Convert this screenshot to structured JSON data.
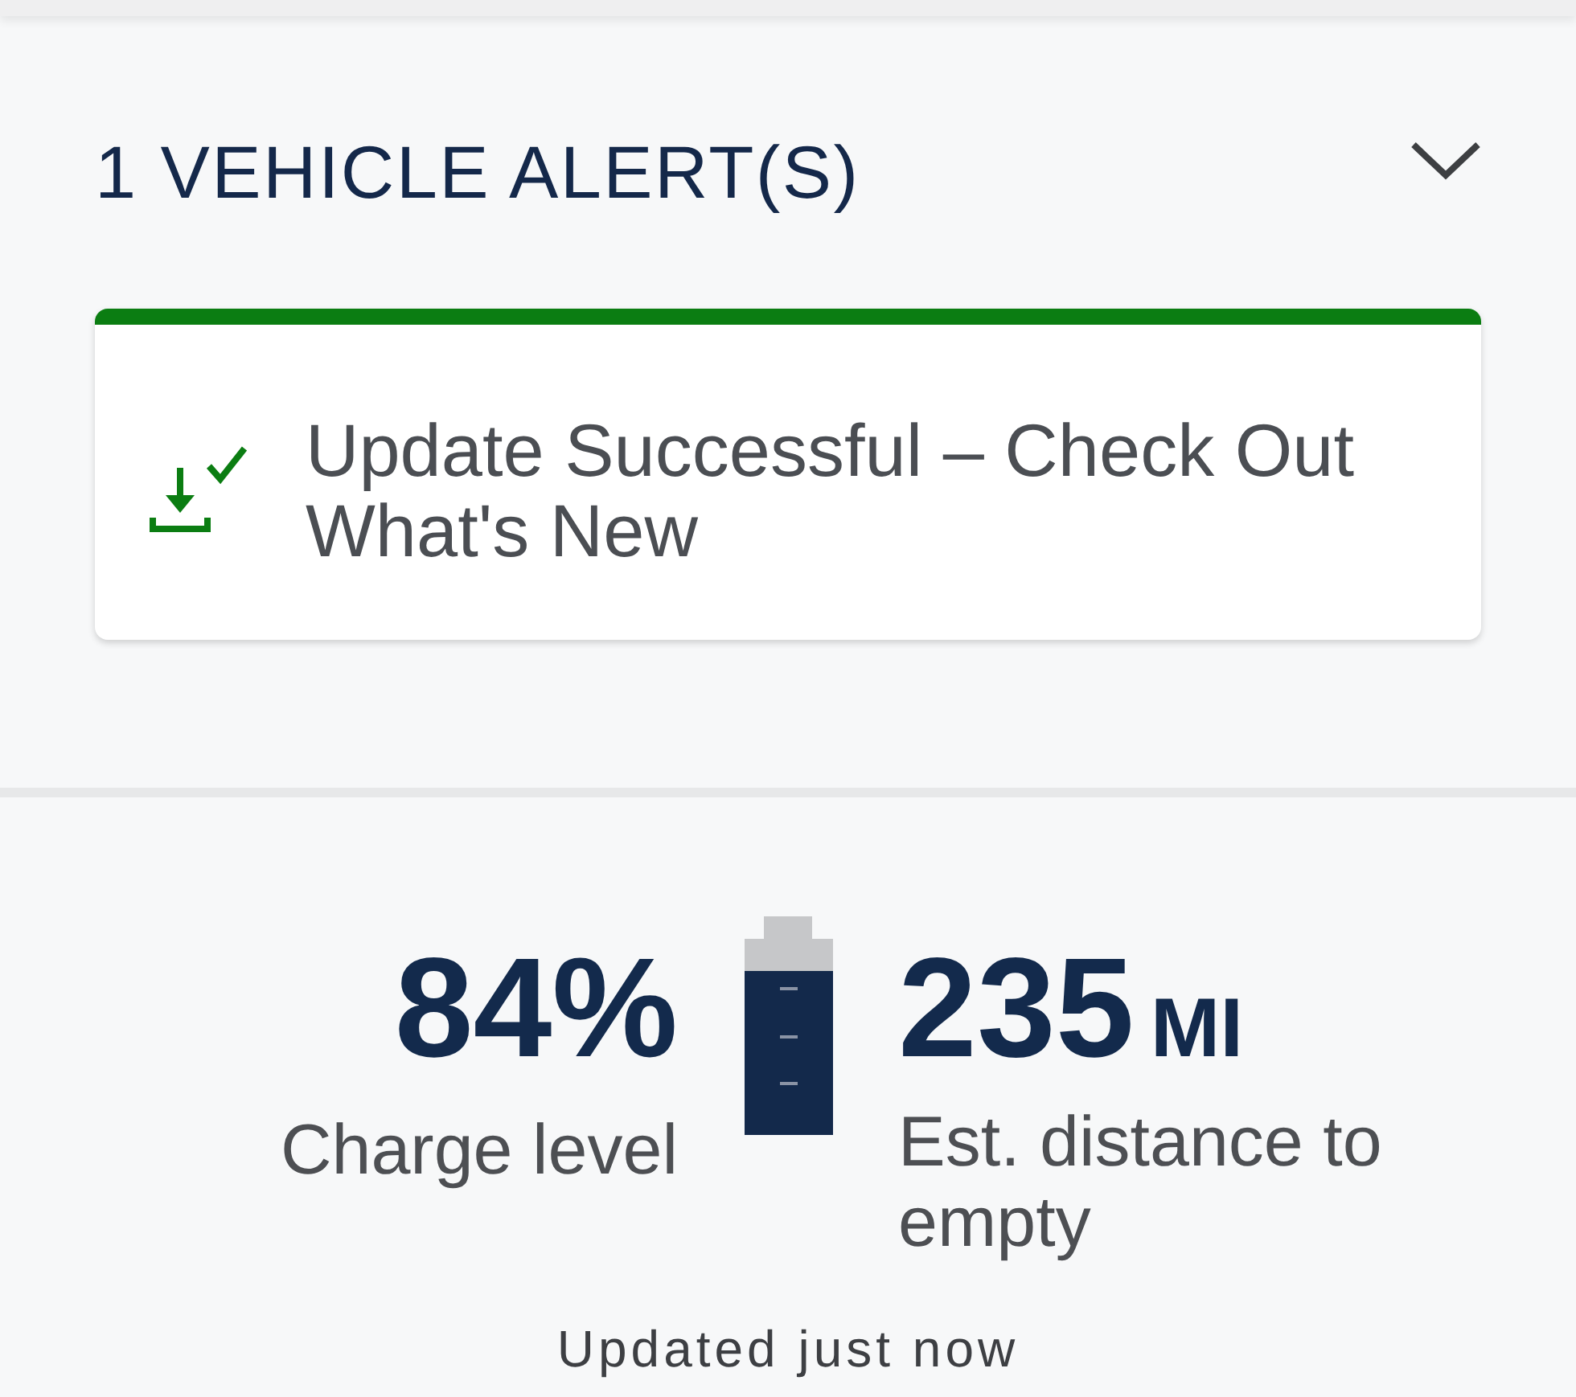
{
  "alerts": {
    "title": "1 VEHICLE ALERT(S)",
    "expanded": true,
    "items": [
      {
        "kind": "success",
        "text": "Update Successful – Check Out What's New"
      }
    ]
  },
  "vehicle_status": {
    "charge": {
      "value": "84%",
      "label": "Charge level",
      "level": 0.84
    },
    "range": {
      "value": "235",
      "unit": "MI",
      "label": "Est. distance to empty"
    },
    "updated": "Updated just now"
  }
}
